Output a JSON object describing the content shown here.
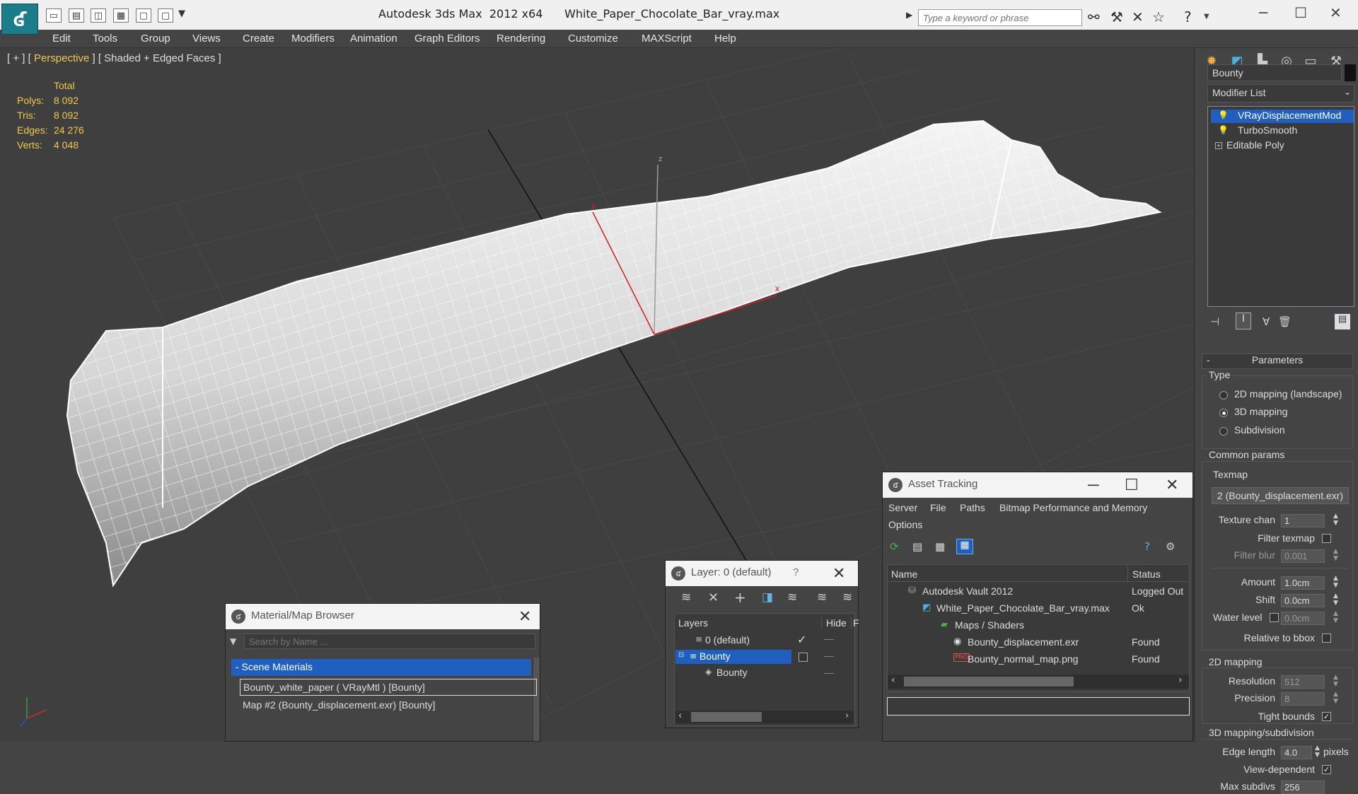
{
  "window": {
    "app_title": "Autodesk 3ds Max  2012 x64",
    "file_title": "White_Paper_Chocolate_Bar_vray.max",
    "search_placeholder": "Type a keyword or phrase"
  },
  "menu": [
    "Edit",
    "Tools",
    "Group",
    "Views",
    "Create",
    "Modifiers",
    "Animation",
    "Graph Editors",
    "Rendering",
    "Customize",
    "MAXScript",
    "Help"
  ],
  "viewport": {
    "label_prefix": "[ + ] [ ",
    "label_view": "Perspective",
    "label_suffix": " ] [ Shaded + Edged Faces ]",
    "stats_header": "Total",
    "stats": [
      {
        "label": "Polys:",
        "value": "8 092"
      },
      {
        "label": "Tris:",
        "value": "8 092"
      },
      {
        "label": "Edges:",
        "value": "24 276"
      },
      {
        "label": "Verts:",
        "value": "4 048"
      }
    ],
    "axis_x": "x",
    "axis_y": "y",
    "axis_z": "z"
  },
  "command_panel": {
    "object_name": "Bounty",
    "modifier_list": "Modifier List",
    "stack": [
      {
        "label": "VRayDisplacementMod",
        "selected": true
      },
      {
        "label": "TurboSmooth",
        "selected": false
      },
      {
        "label": "Editable Poly",
        "selected": false
      }
    ],
    "rollout_title": "Parameters",
    "type_group": "Type",
    "type_options": [
      "2D mapping (landscape)",
      "3D mapping",
      "Subdivision"
    ],
    "common_group": "Common params",
    "texmap_label": "Texmap",
    "texmap_value": "2 (Bounty_displacement.exr)",
    "texture_chan_label": "Texture chan",
    "texture_chan_value": "1",
    "filter_texmap_label": "Filter texmap",
    "filter_blur_label": "Filter blur",
    "filter_blur_value": "0.001",
    "amount_label": "Amount",
    "amount_value": "1.0cm",
    "shift_label": "Shift",
    "shift_value": "0.0cm",
    "water_level_label": "Water level",
    "water_level_value": "0.0cm",
    "relative_bbox_label": "Relative to bbox",
    "mapping2d_group": "2D mapping",
    "resolution_label": "Resolution",
    "resolution_value": "512",
    "precision_label": "Precision",
    "precision_value": "8",
    "tight_bounds_label": "Tight bounds",
    "mapping3d_group": "3D mapping/subdivision",
    "edge_length_label": "Edge length",
    "edge_length_value": "4.0",
    "pixels_label": "pixels",
    "view_dependent_label": "View-dependent",
    "max_subdivs_label": "Max subdivs",
    "max_subdivs_value": "256"
  },
  "material_browser": {
    "title": "Material/Map Browser",
    "search_placeholder": "Search by Name ...",
    "section": "- Scene Materials",
    "items": [
      "Bounty_white_paper  ( VRayMtl )  [Bounty]",
      "Map #2 (Bounty_displacement.exr)  [Bounty]"
    ]
  },
  "layer_dialog": {
    "title": "Layer: 0 (default)",
    "help": "?",
    "col_layers": "Layers",
    "col_hide": "Hide",
    "col_f": "F",
    "rows": [
      {
        "name": "0 (default)",
        "hide": "—",
        "active": "✓"
      },
      {
        "name": "Bounty",
        "hide": "—",
        "active": ""
      },
      {
        "name": "Bounty",
        "hide": "—",
        "active": ""
      }
    ]
  },
  "asset_tracking": {
    "title": "Asset Tracking",
    "menu": [
      "Server",
      "File",
      "Paths",
      "Bitmap Performance and Memory",
      "Options"
    ],
    "col_name": "Name",
    "col_status": "Status",
    "rows": [
      {
        "name": "Autodesk Vault 2012",
        "status": "Logged Out"
      },
      {
        "name": "White_Paper_Chocolate_Bar_vray.max",
        "status": "Ok"
      },
      {
        "name": "Maps / Shaders",
        "status": ""
      },
      {
        "name": "Bounty_displacement.exr",
        "status": "Found"
      },
      {
        "name": "Bounty_normal_map.png",
        "status": "Found"
      }
    ]
  },
  "colors": {
    "accent_blue": "#1f5fbf",
    "stats_yellow": "#f2c94c",
    "viewport_bg": "#3f3f3f"
  }
}
